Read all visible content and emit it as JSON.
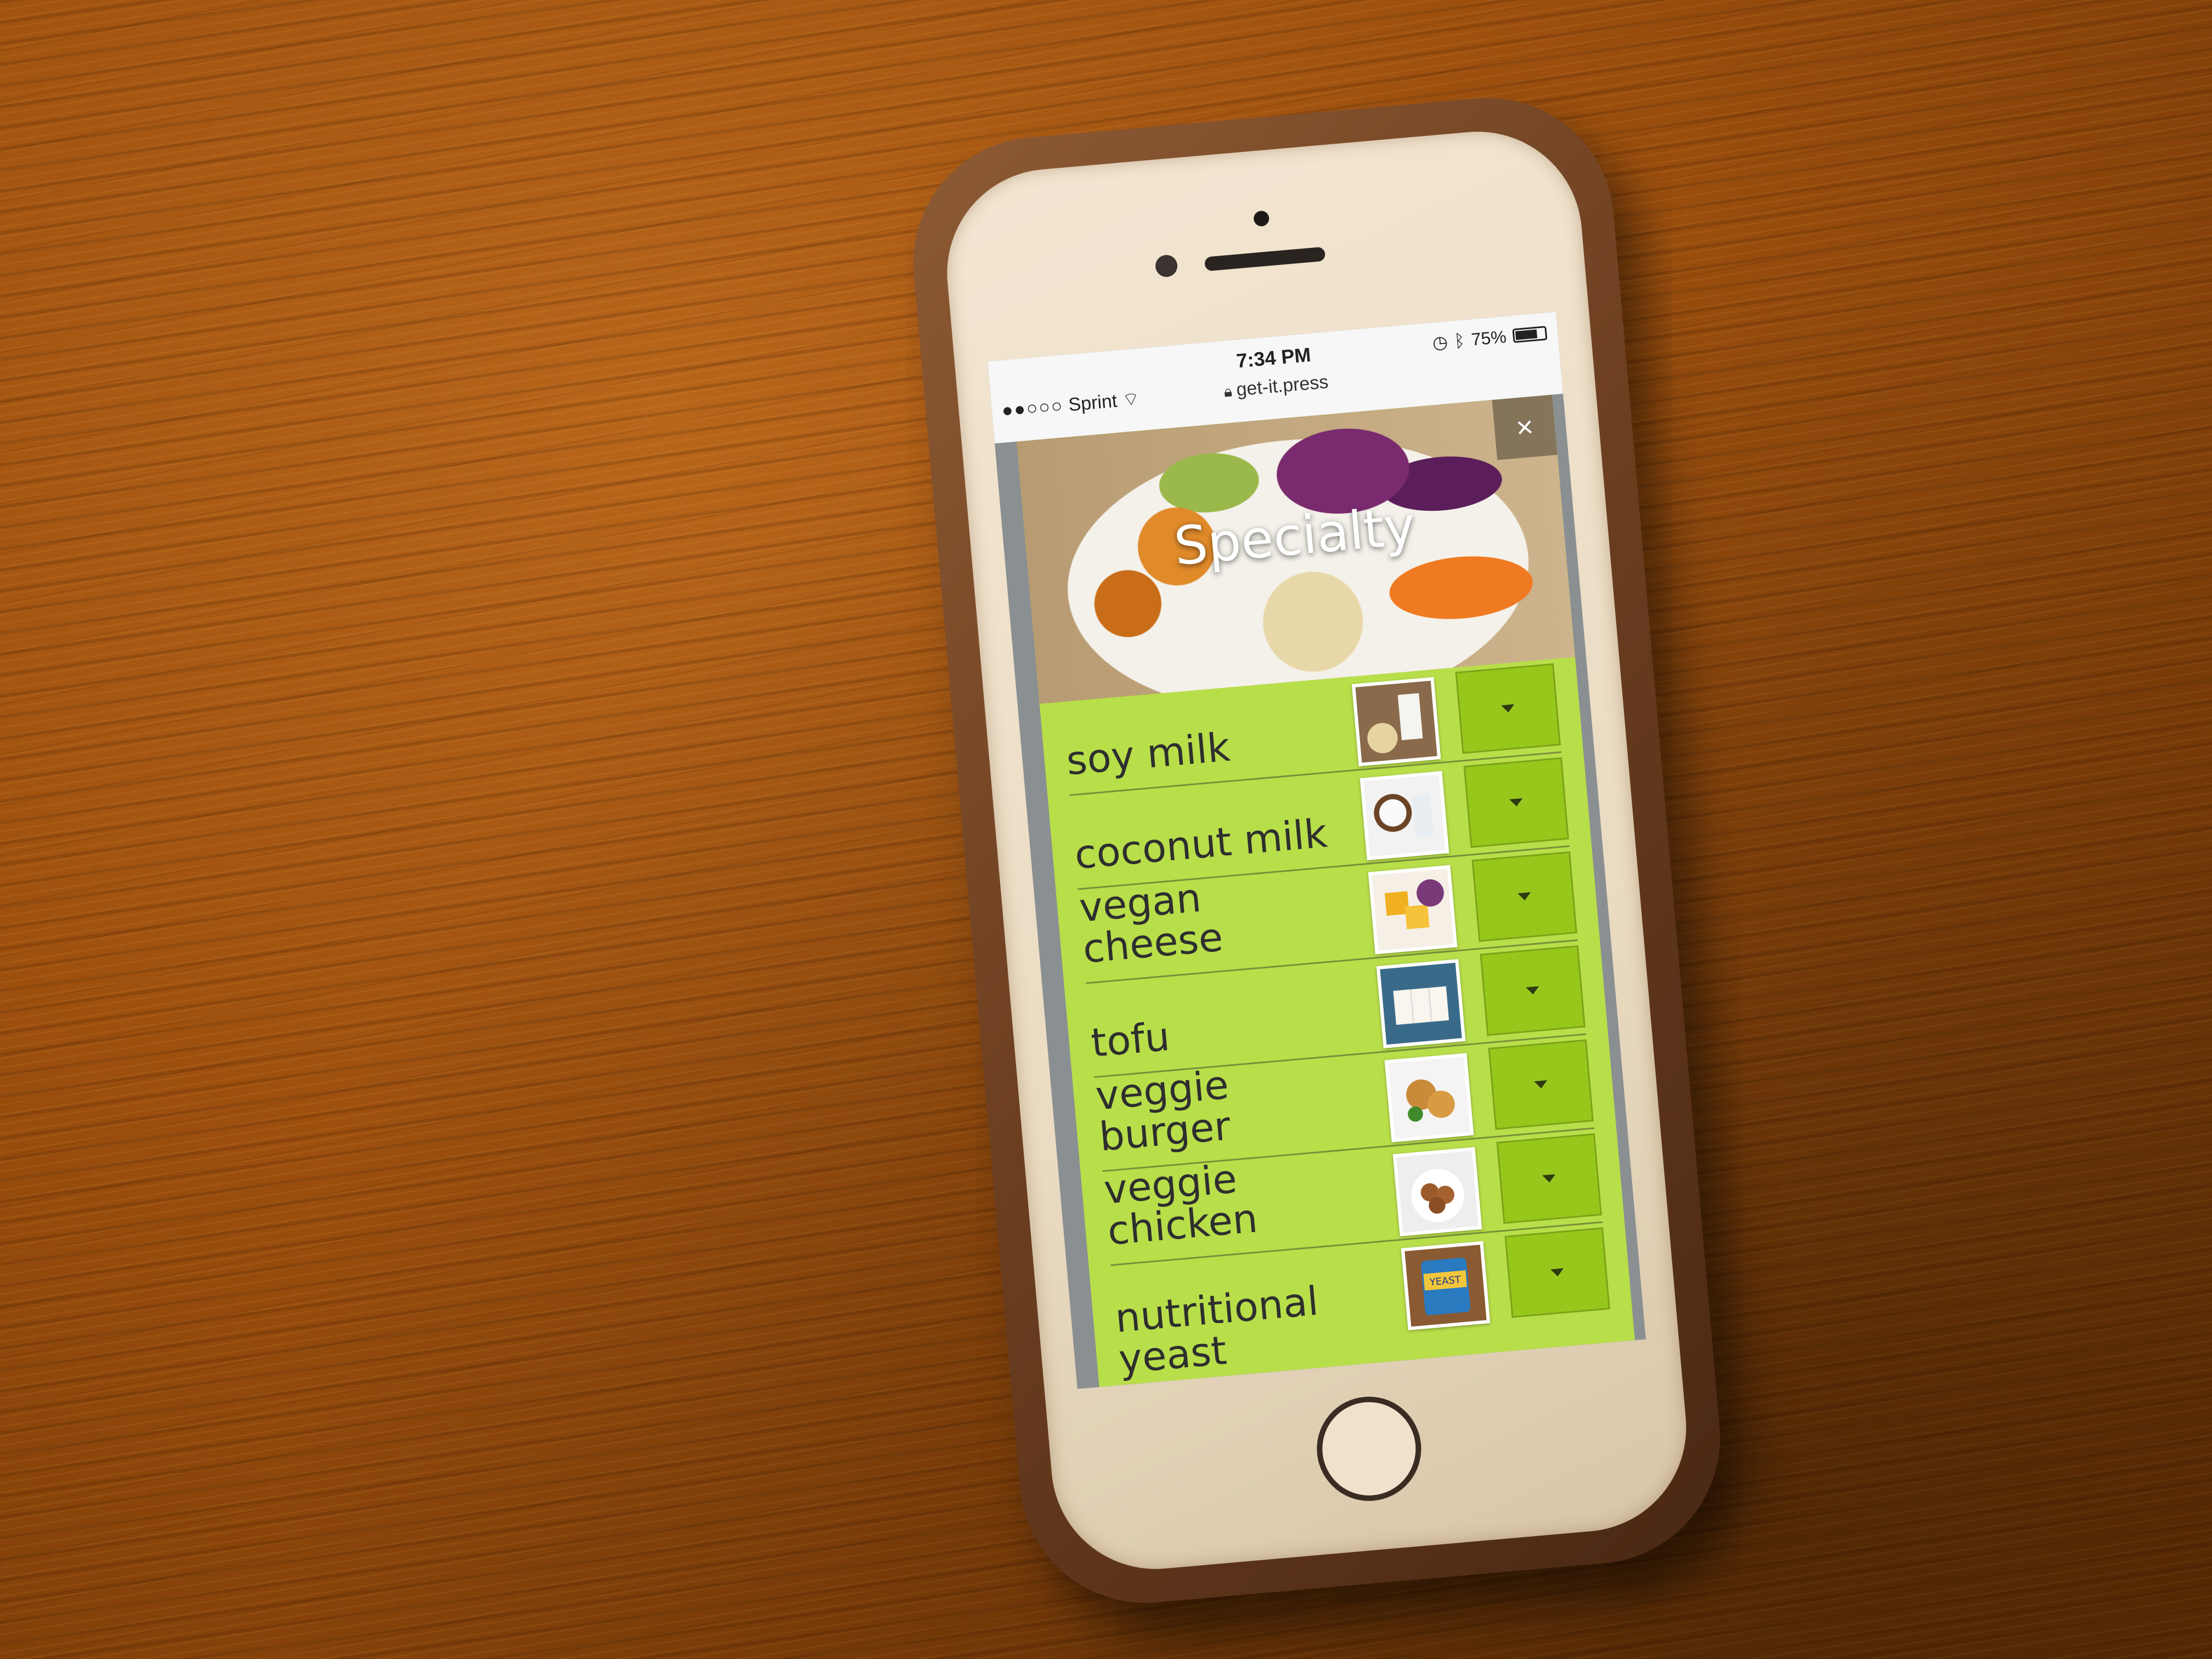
{
  "status_bar": {
    "carrier": "Sprint",
    "time": "7:34 PM",
    "battery": "75%",
    "url": "get-it.press"
  },
  "modal": {
    "title": "Specialty",
    "close_label": "×"
  },
  "items": [
    {
      "label": "soy milk",
      "thumb": "soy-milk-photo"
    },
    {
      "label": "coconut milk",
      "thumb": "coconut-milk-photo"
    },
    {
      "label": "vegan cheese",
      "thumb": "vegan-cheese-photo"
    },
    {
      "label": "tofu",
      "thumb": "tofu-photo"
    },
    {
      "label": "veggie burger",
      "thumb": "veggie-burger-photo"
    },
    {
      "label": "veggie chicken",
      "thumb": "veggie-chicken-photo"
    },
    {
      "label": "nutritional yeast",
      "thumb": "nutritional-yeast-photo",
      "thumb_text": "YEAST"
    }
  ],
  "colors": {
    "panel_green": "#b8de4a",
    "dropdown_green": "#98c71c"
  }
}
